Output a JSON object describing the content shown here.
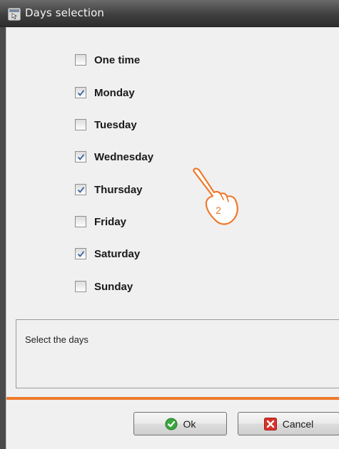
{
  "window": {
    "title": "Days selection",
    "accent_color": "#ee7a2c"
  },
  "days": [
    {
      "label": "One time",
      "checked": false
    },
    {
      "label": "Monday",
      "checked": true
    },
    {
      "label": "Tuesday",
      "checked": false
    },
    {
      "label": "Wednesday",
      "checked": true
    },
    {
      "label": "Thursday",
      "checked": true
    },
    {
      "label": "Friday",
      "checked": false
    },
    {
      "label": "Saturday",
      "checked": true
    },
    {
      "label": "Sunday",
      "checked": false
    }
  ],
  "description": {
    "text": "Select the days"
  },
  "buttons": {
    "ok_label": "Ok",
    "ok_icon": "check-circle-icon",
    "cancel_label": "Cancel",
    "cancel_icon": "red-x-icon"
  },
  "annotation": {
    "step_number": "2",
    "icon": "pointing-hand-icon"
  }
}
